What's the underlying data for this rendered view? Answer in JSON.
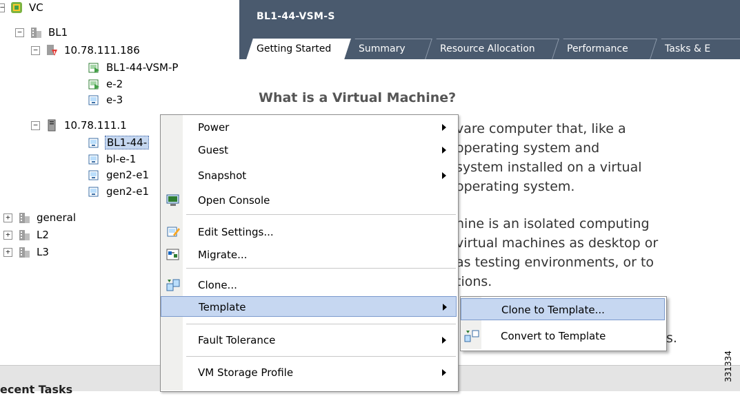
{
  "tree": {
    "root": "VC",
    "datacenter": "BL1",
    "host1": "10.78.111.186",
    "host1_vms": [
      "BL1-44-VSM-P",
      "e-2",
      "e-3"
    ],
    "host2": "10.78.111.1",
    "host2_vms": [
      "BL1-44-",
      "bl-e-1",
      "gen2-e1",
      "gen2-e1"
    ],
    "folders": [
      "general",
      "L2",
      "L3"
    ],
    "expand_symbol": "+",
    "collapse_symbol": "−"
  },
  "right_pane": {
    "title": "BL1-44-VSM-S",
    "tabs": [
      "Getting Started",
      "Summary",
      "Resource Allocation",
      "Performance",
      "Tasks & E"
    ],
    "heading": "What is a Virtual Machine?",
    "para_lines": [
      "vare computer that, like a",
      "operating system and",
      "system installed on a virtual",
      "operating system.",
      "hine is an isolated computing",
      "virtual machines as desktop or",
      "as testing environments, or to",
      "tions.",
      "s."
    ]
  },
  "context_menu": {
    "items": [
      "Power",
      "Guest",
      "Snapshot",
      "Open Console",
      "Edit Settings...",
      "Migrate...",
      "Clone...",
      "Template",
      "Fault Tolerance",
      "VM Storage Profile"
    ],
    "highlighted": "Template"
  },
  "submenu": {
    "items": [
      "Clone to Template...",
      "Convert to Template"
    ],
    "highlighted": "Clone to Template..."
  },
  "bottom": {
    "recent_tasks": "ecent Tasks",
    "image_id": "331334"
  },
  "icons": {
    "vcenter": "vcenter-icon",
    "datacenter": "datacenter-icon",
    "host": "host-icon",
    "vm_on": "vm-powered-on-icon",
    "vm_off": "vm-icon"
  },
  "colors": {
    "header_bg": "#4a5a6e",
    "highlight_bg": "#c6d7f1",
    "selection_bg": "#c5d7f0"
  }
}
